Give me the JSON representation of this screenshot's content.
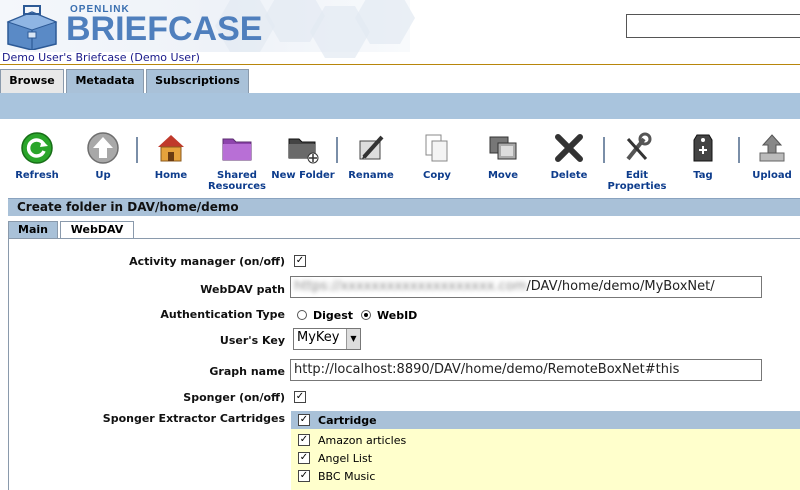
{
  "header": {
    "logo_top": "OPENLINK",
    "logo_main": "BRIEFCASE",
    "search_value": ""
  },
  "user_line": "Demo User's Briefcase (Demo User)",
  "top_tabs": [
    {
      "label": "Browse",
      "active": true
    },
    {
      "label": "Metadata",
      "active": false
    },
    {
      "label": "Subscriptions",
      "active": false
    }
  ],
  "toolbar": {
    "refresh": "Refresh",
    "up": "Up",
    "home": "Home",
    "shared_resources": "Shared Resources",
    "new_folder": "New Folder",
    "rename": "Rename",
    "copy": "Copy",
    "move": "Move",
    "delete": "Delete",
    "edit_properties": "Edit Properties",
    "tag": "Tag",
    "upload": "Upload"
  },
  "section_title": "Create folder in DAV/home/demo",
  "inner_tabs": [
    {
      "label": "Main",
      "active": false
    },
    {
      "label": "WebDAV",
      "active": true
    }
  ],
  "form": {
    "activity_manager_label": "Activity manager (on/off)",
    "activity_manager_checked": "✓",
    "webdav_path_label": "WebDAV path",
    "webdav_path_blurred": "https://xxxxxxxxxxxxxxxxxxxx.com",
    "webdav_path_value": "/DAV/home/demo/MyBoxNet/",
    "auth_type_label": "Authentication Type",
    "auth_digest": "Digest",
    "auth_webid": "WebID",
    "auth_selected": "WebID",
    "users_key_label": "User's Key",
    "users_key_value": "MyKey",
    "graph_name_label": "Graph name",
    "graph_name_value": "http://localhost:8890/DAV/home/demo/RemoteBoxNet#this",
    "sponger_label": "Sponger (on/off)",
    "sponger_checked": "✓",
    "cartridges_label": "Sponger Extractor Cartridges"
  },
  "cartridges": {
    "header": "Cartridge",
    "rows": [
      "Amazon articles",
      "Angel List",
      "BBC Music"
    ],
    "check": "✓"
  },
  "colors": {
    "tab_blue": "#a9c1d8",
    "link_blue": "#0d3c8c",
    "cartridge_bg": "#ffffcc"
  }
}
